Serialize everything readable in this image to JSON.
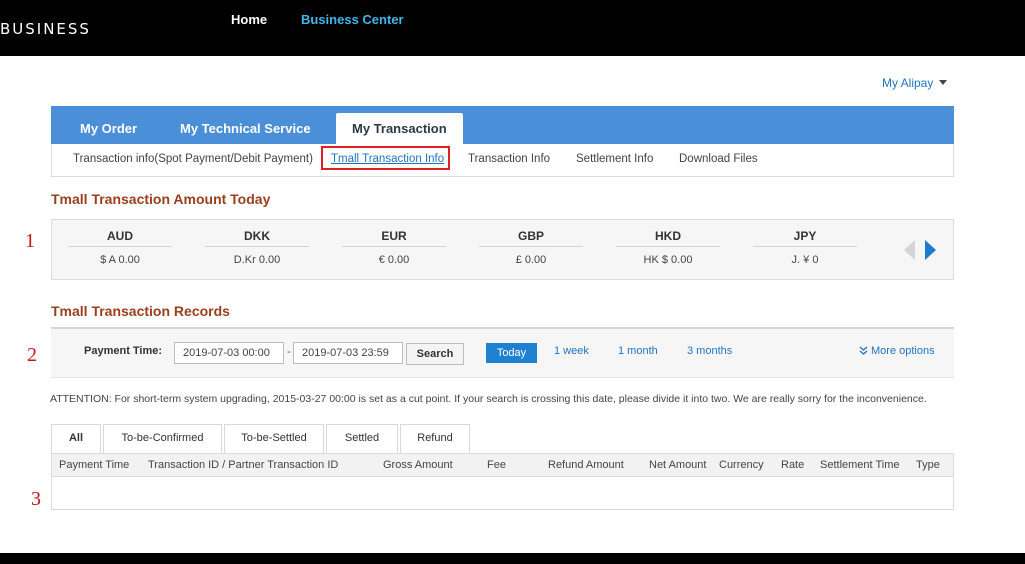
{
  "header": {
    "logo": "BUSINESS",
    "nav": {
      "home": "Home",
      "business_center": "Business Center"
    }
  },
  "account_menu": {
    "label": "My Alipay"
  },
  "main_tabs": [
    "My Order",
    "My Technical Service",
    "My Transaction"
  ],
  "active_main_tab": "My Transaction",
  "sub_nav": [
    "Transaction info(Spot Payment/Debit Payment)",
    "Tmall Transaction Info",
    "Transaction Info",
    "Settlement Info",
    "Download Files"
  ],
  "active_sub_nav": "Tmall Transaction Info",
  "amount_today": {
    "title": "Tmall Transaction Amount Today",
    "currencies": [
      {
        "code": "AUD",
        "amount": "$ A 0.00"
      },
      {
        "code": "DKK",
        "amount": "D.Kr 0.00"
      },
      {
        "code": "EUR",
        "amount": "€ 0.00"
      },
      {
        "code": "GBP",
        "amount": "£  0.00"
      },
      {
        "code": "HKD",
        "amount": "HK $  0.00"
      },
      {
        "code": "JPY",
        "amount": "J. ¥  0"
      }
    ]
  },
  "records": {
    "title": "Tmall Transaction Records",
    "search": {
      "payment_time_label": "Payment Time:",
      "start": "2019-07-03 00:00",
      "separator": "-",
      "end": "2019-07-03 23:59",
      "search_button": "Search",
      "ranges": [
        "Today",
        "1 week",
        "1 month",
        "3 months"
      ],
      "active_range": "Today",
      "more_options": "More options"
    },
    "attention": "ATTENTION: For short-term system upgrading, 2015-03-27 00:00 is set as a cut point. If your search is crossing this date, please divide it into two. We are really sorry for the inconvenience.",
    "tabs": [
      "All",
      "To-be-Confirmed",
      "To-be-Settled",
      "Settled",
      "Refund"
    ],
    "active_tab": "All",
    "columns": [
      "Payment Time",
      "Transaction ID / Partner Transaction ID",
      "Gross Amount",
      "Fee",
      "Refund Amount",
      "Net Amount",
      "Currency",
      "Rate",
      "Settlement Time",
      "Type"
    ]
  },
  "annotations": [
    "1",
    "2",
    "3"
  ],
  "colors": {
    "top_bar": "#000000",
    "tab_strip": "#4a8fd8",
    "link": "#1f74c2",
    "section_title": "#9a3f1c",
    "annotation": "#c2151b",
    "highlight_box": "#e02020",
    "today_button": "#1f80d0"
  }
}
